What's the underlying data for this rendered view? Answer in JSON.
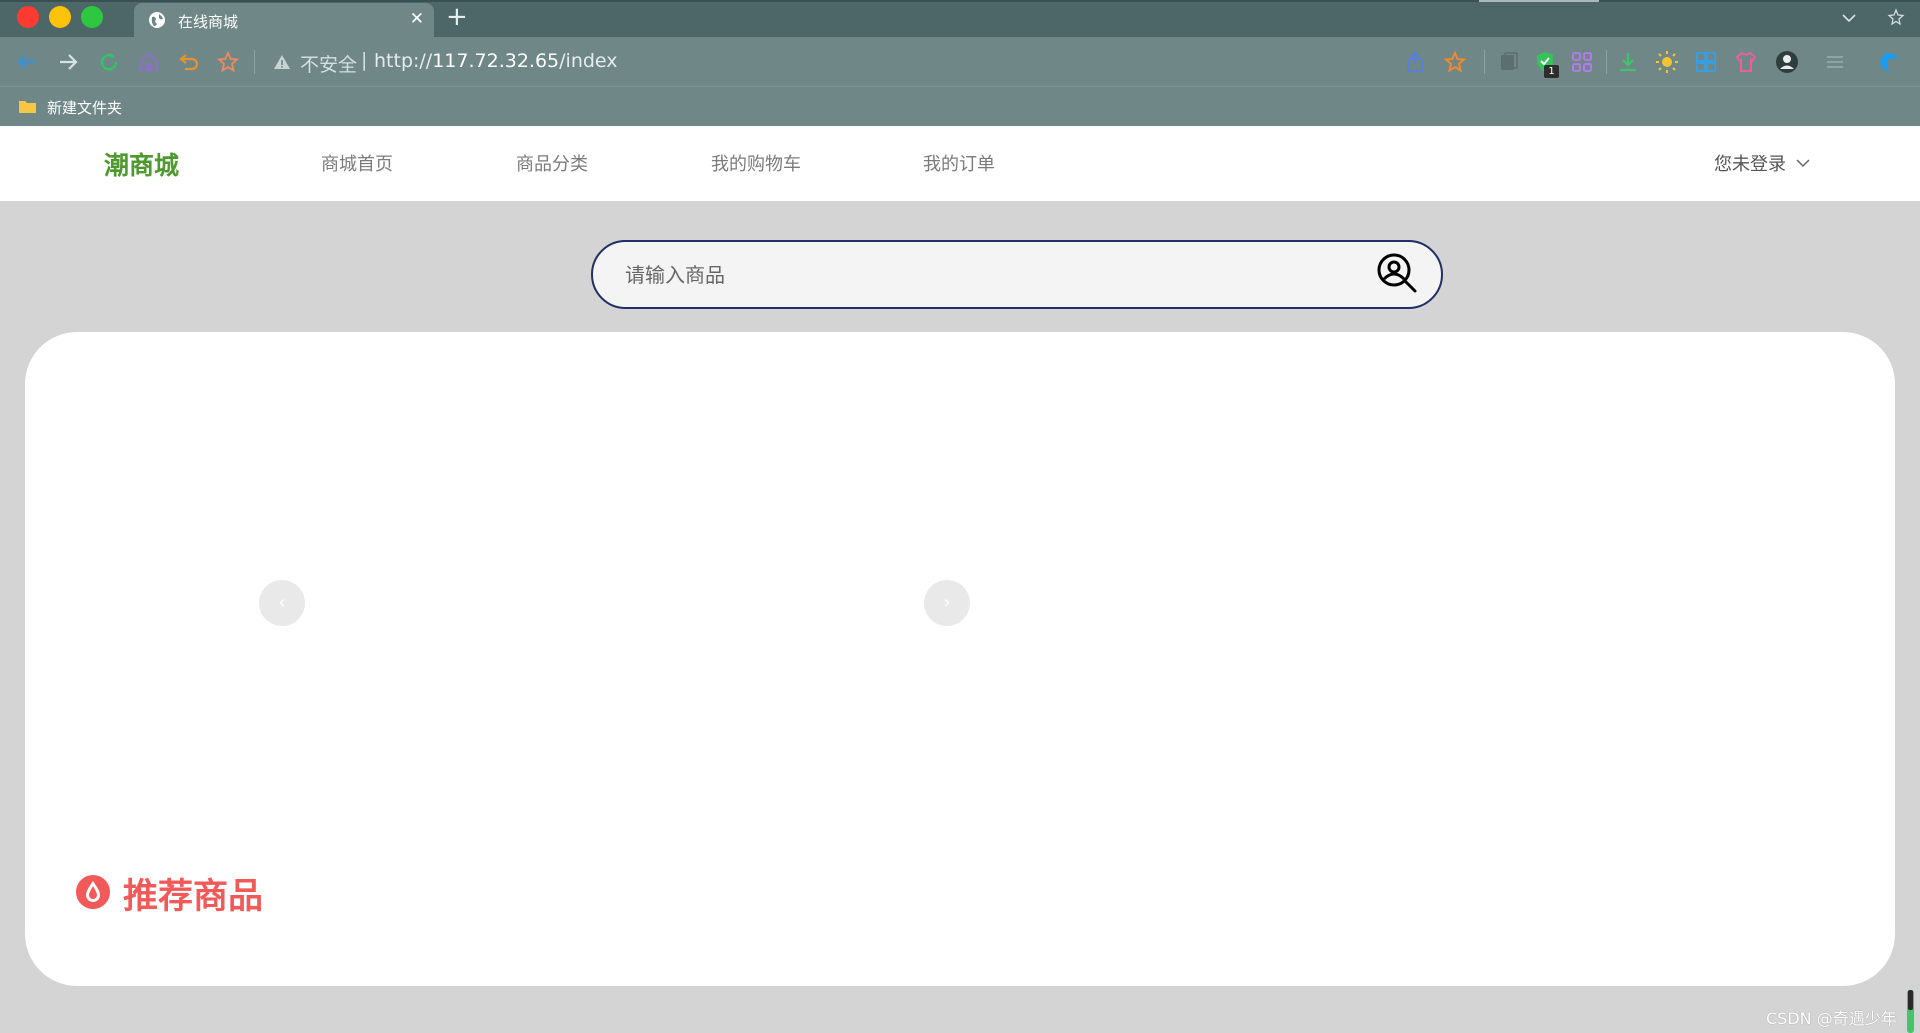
{
  "browser": {
    "tab_title": "在线商城",
    "new_tab": "+",
    "close": "✕",
    "insecure_label": "不安全",
    "url_scheme": "http://",
    "url_host": "117.72.32.65",
    "url_path": "/index",
    "extension_badge": "1",
    "bookmark_folder": "新建文件夹",
    "icons": [
      "back-icon",
      "forward-icon",
      "reload-icon",
      "home-icon",
      "undo-icon",
      "star-icon",
      "share-icon",
      "bookmark-star-icon",
      "extensions-icon",
      "shield-icon",
      "apps-icon",
      "download-icon",
      "sun-icon",
      "grid-icon",
      "shirt-icon",
      "profile-icon",
      "menu-icon",
      "edge-icon"
    ]
  },
  "site": {
    "logo": "潮商城",
    "nav": [
      "商城首页",
      "商品分类",
      "我的购物车",
      "我的订单"
    ],
    "user_menu": "您未登录",
    "search_placeholder": "请输入商品",
    "carousel_prev": "‹",
    "carousel_next": "›",
    "section_title": "推荐商品"
  },
  "watermark": "CSDN @奇遇少年",
  "colors": {
    "chrome_dark": "#4d6768",
    "chrome": "#6f8787",
    "logo_green": "#4e9a2e",
    "accent_red": "#f25a5a",
    "search_border": "#1f2e66",
    "page_bg": "#d4d4d4"
  }
}
